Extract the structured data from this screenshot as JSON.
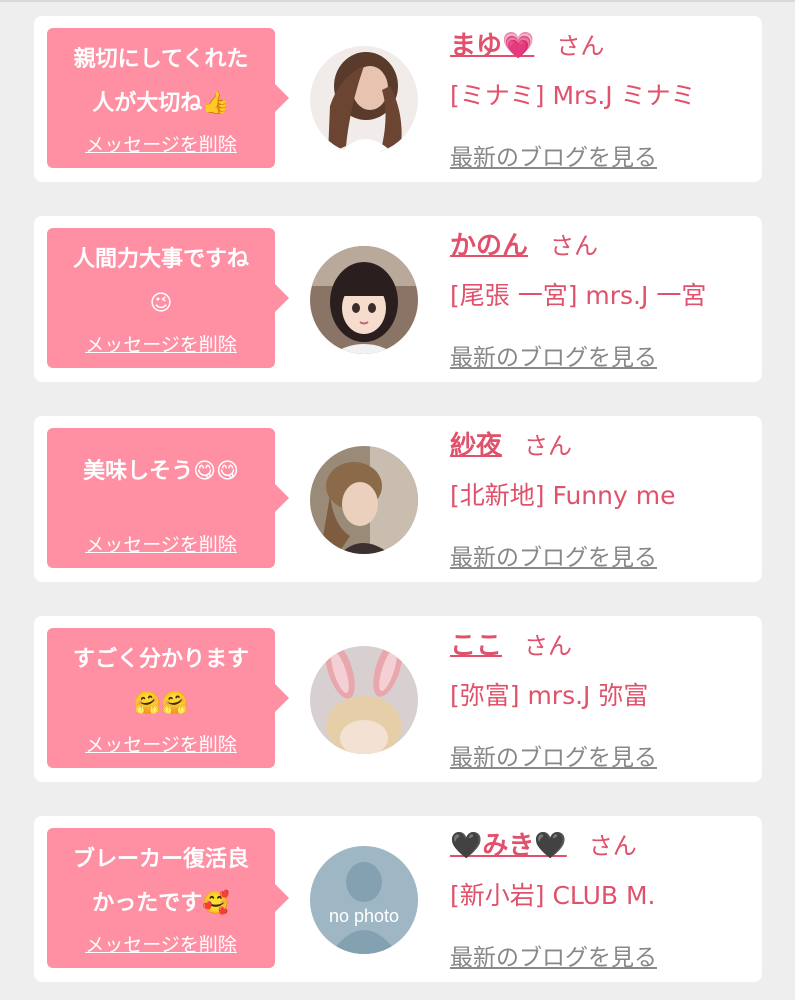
{
  "colors": {
    "accent": "#e0516b",
    "bubble": "#ff8fa3",
    "background": "#eeeeee",
    "link_gray": "#888888"
  },
  "messages": [
    {
      "message": "親切にしてくれた\n人が大切ね👍",
      "delete_label": "メッセージを削除",
      "name": "まゆ💗",
      "honorific": "さん",
      "shop": "[ミナミ] Mrs.J ミナミ",
      "blog_link": "最新のブログを見る",
      "avatar_icon": "woman-long-hair-photo"
    },
    {
      "message": "人間力大事ですね\n😉",
      "delete_label": "メッセージを削除",
      "name": "かのん",
      "honorific": "さん",
      "shop": "[尾張 一宮] mrs.J 一宮",
      "blog_link": "最新のブログを見る",
      "avatar_icon": "anime-girl-illustration"
    },
    {
      "message": "美味しそう😋😋",
      "delete_label": "メッセージを削除",
      "name": "紗夜",
      "honorific": "さん",
      "shop": "[北新地] Funny me",
      "blog_link": "最新のブログを見る",
      "avatar_icon": "woman-updo-photo"
    },
    {
      "message": "すごく分かります\n🤗🤗",
      "delete_label": "メッセージを削除",
      "name": "ここ",
      "honorific": "さん",
      "shop": "[弥富] mrs.J 弥富",
      "blog_link": "最新のブログを見る",
      "avatar_icon": "bunny-ears-photo"
    },
    {
      "message": "ブレーカー復活良\nかったです🥰",
      "delete_label": "メッセージを削除",
      "name": "🖤みき🖤",
      "honorific": "さん",
      "shop": "[新小岩] CLUB M.",
      "blog_link": "最新のブログを見る",
      "avatar_icon": "no-photo-placeholder",
      "avatar_text": "no photo"
    }
  ]
}
